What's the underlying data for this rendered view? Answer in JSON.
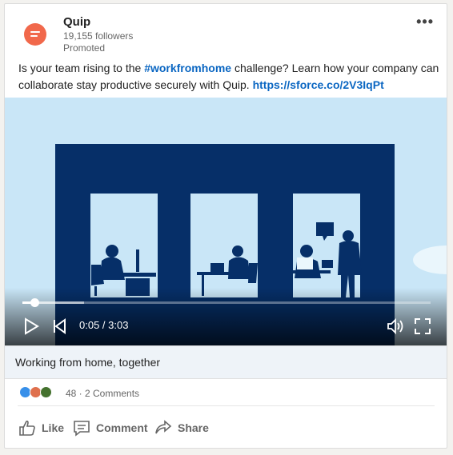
{
  "post": {
    "company_name": "Quip",
    "followers": "19,155 followers",
    "promoted": "Promoted",
    "text_before": "Is your team rising to the ",
    "hashtag": "#workfromhome",
    "text_after": " challenge? Learn how your company can collaborate stay productive securely with Quip. ",
    "link": "https://sforce.co/2V3IqPt"
  },
  "video": {
    "current_time": "0:05 / 3:03",
    "progress_fraction": 0.03,
    "buffered_fraction": 0.15,
    "caption": "Working from home, together"
  },
  "social": {
    "counts": "48 · 2 Comments",
    "reactions": [
      "like-reaction-icon",
      "love-reaction-icon",
      "celebrate-reaction-icon"
    ]
  },
  "actions": {
    "like": "Like",
    "comment": "Comment",
    "share": "Share"
  },
  "colors": {
    "brand": "#f1684b",
    "link": "#0a66c2",
    "building": "#062f68",
    "sky": "#c9e6f7"
  }
}
